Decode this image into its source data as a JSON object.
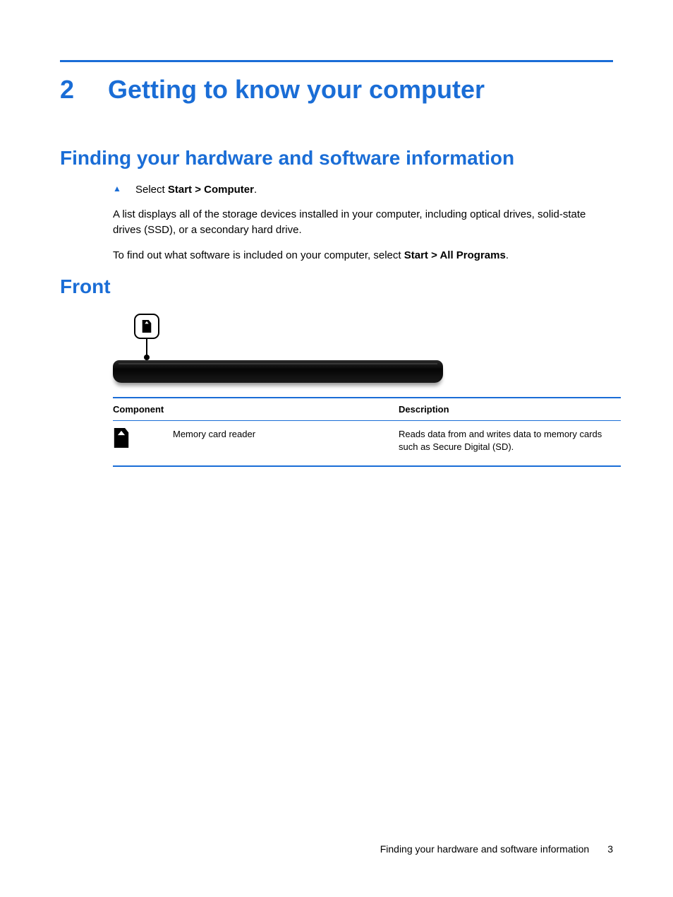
{
  "chapter": {
    "number": "2",
    "title": "Getting to know your computer"
  },
  "section1": {
    "heading": "Finding your hardware and software information",
    "bullet_prefix": "Select ",
    "bullet_bold": "Start > Computer",
    "bullet_suffix": ".",
    "para1": "A list displays all of the storage devices installed in your computer, including optical drives, solid-state drives (SSD), or a secondary hard drive.",
    "para2_prefix": "To find out what software is included on your computer, select ",
    "para2_bold": "Start > All Programs",
    "para2_suffix": "."
  },
  "section2": {
    "heading": "Front"
  },
  "table": {
    "headers": {
      "component": "Component",
      "description": "Description"
    },
    "row1": {
      "component": "Memory card reader",
      "description": "Reads data from and writes data to memory cards such as Secure Digital (SD)."
    }
  },
  "footer": {
    "text": "Finding your hardware and software information",
    "page": "3"
  }
}
